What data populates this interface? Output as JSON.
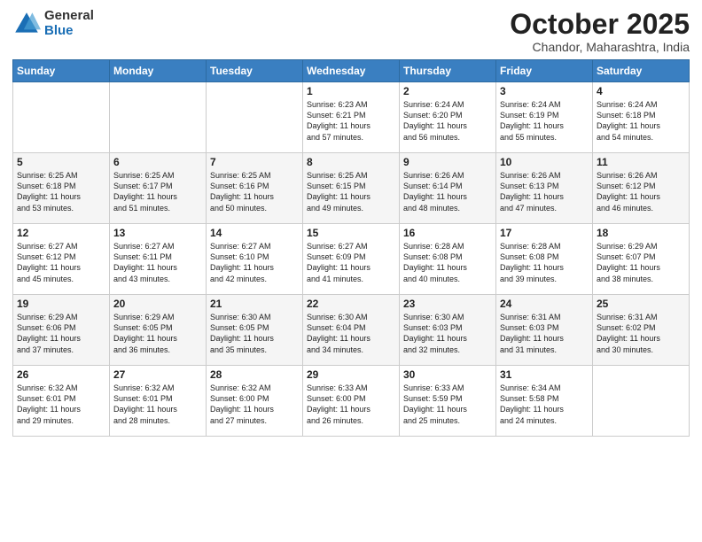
{
  "header": {
    "logo_general": "General",
    "logo_blue": "Blue",
    "month_title": "October 2025",
    "location": "Chandor, Maharashtra, India"
  },
  "weekdays": [
    "Sunday",
    "Monday",
    "Tuesday",
    "Wednesday",
    "Thursday",
    "Friday",
    "Saturday"
  ],
  "weeks": [
    [
      {
        "day": "",
        "info": ""
      },
      {
        "day": "",
        "info": ""
      },
      {
        "day": "",
        "info": ""
      },
      {
        "day": "1",
        "info": "Sunrise: 6:23 AM\nSunset: 6:21 PM\nDaylight: 11 hours\nand 57 minutes."
      },
      {
        "day": "2",
        "info": "Sunrise: 6:24 AM\nSunset: 6:20 PM\nDaylight: 11 hours\nand 56 minutes."
      },
      {
        "day": "3",
        "info": "Sunrise: 6:24 AM\nSunset: 6:19 PM\nDaylight: 11 hours\nand 55 minutes."
      },
      {
        "day": "4",
        "info": "Sunrise: 6:24 AM\nSunset: 6:18 PM\nDaylight: 11 hours\nand 54 minutes."
      }
    ],
    [
      {
        "day": "5",
        "info": "Sunrise: 6:25 AM\nSunset: 6:18 PM\nDaylight: 11 hours\nand 53 minutes."
      },
      {
        "day": "6",
        "info": "Sunrise: 6:25 AM\nSunset: 6:17 PM\nDaylight: 11 hours\nand 51 minutes."
      },
      {
        "day": "7",
        "info": "Sunrise: 6:25 AM\nSunset: 6:16 PM\nDaylight: 11 hours\nand 50 minutes."
      },
      {
        "day": "8",
        "info": "Sunrise: 6:25 AM\nSunset: 6:15 PM\nDaylight: 11 hours\nand 49 minutes."
      },
      {
        "day": "9",
        "info": "Sunrise: 6:26 AM\nSunset: 6:14 PM\nDaylight: 11 hours\nand 48 minutes."
      },
      {
        "day": "10",
        "info": "Sunrise: 6:26 AM\nSunset: 6:13 PM\nDaylight: 11 hours\nand 47 minutes."
      },
      {
        "day": "11",
        "info": "Sunrise: 6:26 AM\nSunset: 6:12 PM\nDaylight: 11 hours\nand 46 minutes."
      }
    ],
    [
      {
        "day": "12",
        "info": "Sunrise: 6:27 AM\nSunset: 6:12 PM\nDaylight: 11 hours\nand 45 minutes."
      },
      {
        "day": "13",
        "info": "Sunrise: 6:27 AM\nSunset: 6:11 PM\nDaylight: 11 hours\nand 43 minutes."
      },
      {
        "day": "14",
        "info": "Sunrise: 6:27 AM\nSunset: 6:10 PM\nDaylight: 11 hours\nand 42 minutes."
      },
      {
        "day": "15",
        "info": "Sunrise: 6:27 AM\nSunset: 6:09 PM\nDaylight: 11 hours\nand 41 minutes."
      },
      {
        "day": "16",
        "info": "Sunrise: 6:28 AM\nSunset: 6:08 PM\nDaylight: 11 hours\nand 40 minutes."
      },
      {
        "day": "17",
        "info": "Sunrise: 6:28 AM\nSunset: 6:08 PM\nDaylight: 11 hours\nand 39 minutes."
      },
      {
        "day": "18",
        "info": "Sunrise: 6:29 AM\nSunset: 6:07 PM\nDaylight: 11 hours\nand 38 minutes."
      }
    ],
    [
      {
        "day": "19",
        "info": "Sunrise: 6:29 AM\nSunset: 6:06 PM\nDaylight: 11 hours\nand 37 minutes."
      },
      {
        "day": "20",
        "info": "Sunrise: 6:29 AM\nSunset: 6:05 PM\nDaylight: 11 hours\nand 36 minutes."
      },
      {
        "day": "21",
        "info": "Sunrise: 6:30 AM\nSunset: 6:05 PM\nDaylight: 11 hours\nand 35 minutes."
      },
      {
        "day": "22",
        "info": "Sunrise: 6:30 AM\nSunset: 6:04 PM\nDaylight: 11 hours\nand 34 minutes."
      },
      {
        "day": "23",
        "info": "Sunrise: 6:30 AM\nSunset: 6:03 PM\nDaylight: 11 hours\nand 32 minutes."
      },
      {
        "day": "24",
        "info": "Sunrise: 6:31 AM\nSunset: 6:03 PM\nDaylight: 11 hours\nand 31 minutes."
      },
      {
        "day": "25",
        "info": "Sunrise: 6:31 AM\nSunset: 6:02 PM\nDaylight: 11 hours\nand 30 minutes."
      }
    ],
    [
      {
        "day": "26",
        "info": "Sunrise: 6:32 AM\nSunset: 6:01 PM\nDaylight: 11 hours\nand 29 minutes."
      },
      {
        "day": "27",
        "info": "Sunrise: 6:32 AM\nSunset: 6:01 PM\nDaylight: 11 hours\nand 28 minutes."
      },
      {
        "day": "28",
        "info": "Sunrise: 6:32 AM\nSunset: 6:00 PM\nDaylight: 11 hours\nand 27 minutes."
      },
      {
        "day": "29",
        "info": "Sunrise: 6:33 AM\nSunset: 6:00 PM\nDaylight: 11 hours\nand 26 minutes."
      },
      {
        "day": "30",
        "info": "Sunrise: 6:33 AM\nSunset: 5:59 PM\nDaylight: 11 hours\nand 25 minutes."
      },
      {
        "day": "31",
        "info": "Sunrise: 6:34 AM\nSunset: 5:58 PM\nDaylight: 11 hours\nand 24 minutes."
      },
      {
        "day": "",
        "info": ""
      }
    ]
  ]
}
